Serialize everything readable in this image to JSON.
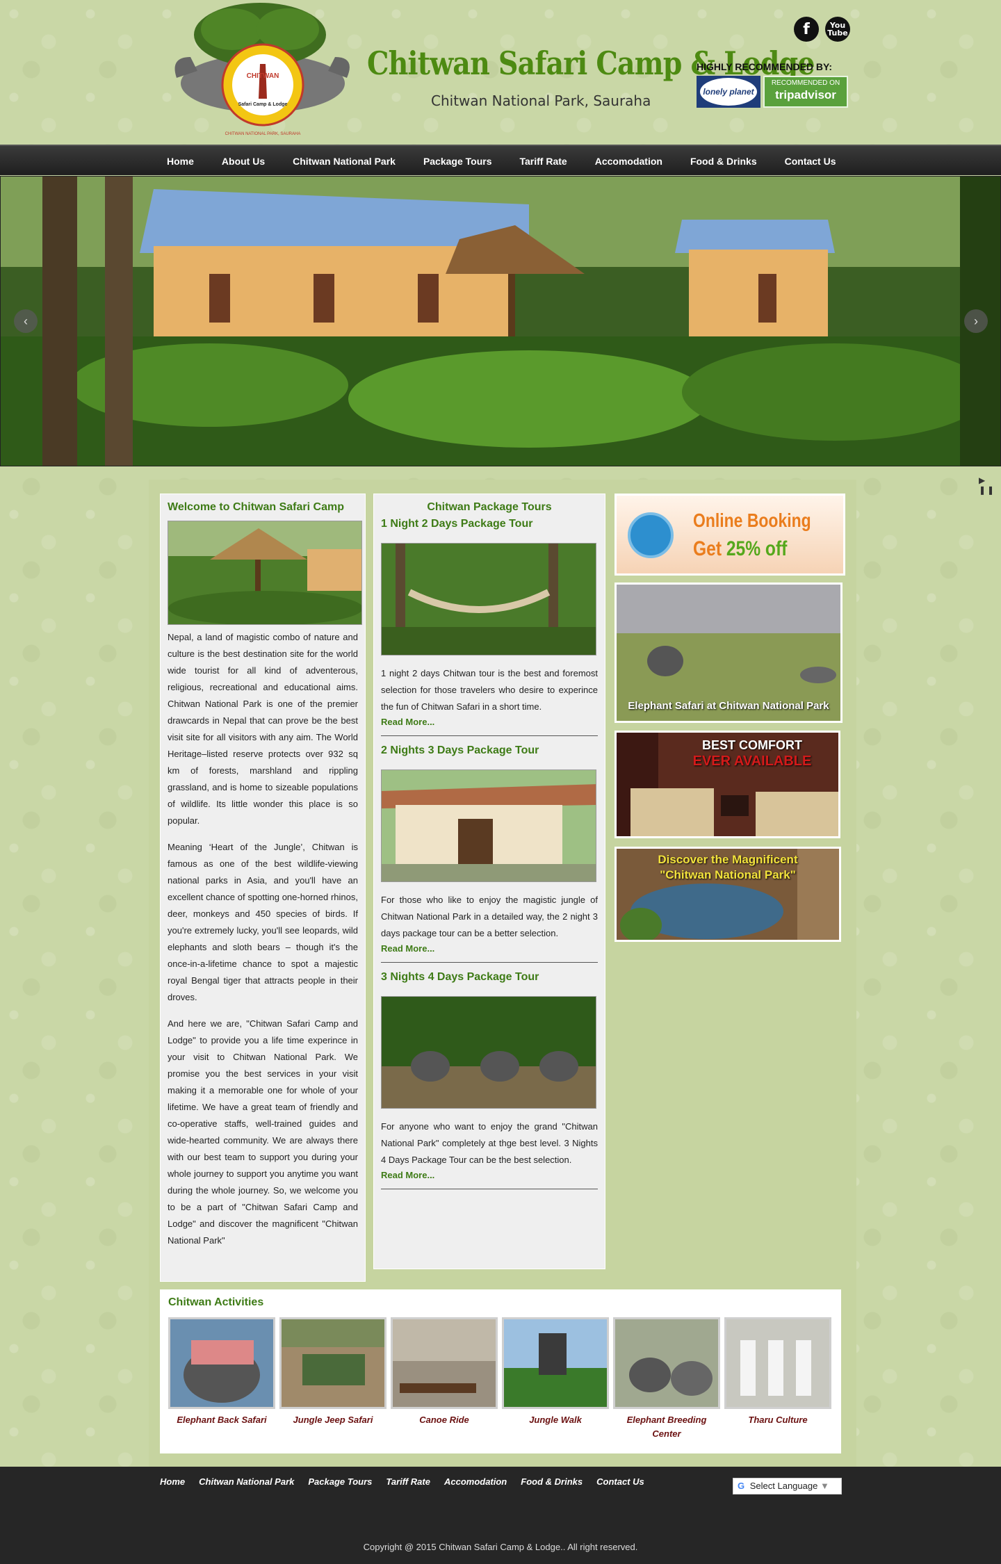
{
  "header": {
    "title": "Chitwan Safari Camp & Lodge",
    "subtitle": "Chitwan National Park, Sauraha",
    "recommended_label": "HIGHLY RECOMMENDED BY:",
    "logo_text_top": "CHITWAN",
    "logo_text_mid": "Safari Camp & Lodge",
    "logo_text_ring": "CHITWAN NATIONAL PARK, SAURAHA",
    "lonely_planet": "lonely planet",
    "tripadvisor_small": "RECOMMENDED ON",
    "tripadvisor_big": "tripadvisor",
    "social_facebook": "f",
    "social_youtube": "You Tube"
  },
  "nav": [
    "Home",
    "About Us",
    "Chitwan National Park",
    "Package Tours",
    "Tariff Rate",
    "Accomodation",
    "Food & Drinks",
    "Contact Us"
  ],
  "slider": {
    "prev": "‹",
    "next": "›",
    "controls": "▶ ❚❚"
  },
  "welcome": {
    "title": "Welcome to Chitwan Safari Camp",
    "paragraphs": [
      "Nepal, a land of magistic combo of nature and culture is the best destination site for the world wide tourist for all kind of adventerous, religious, recreational and educational aims. Chitwan National Park is one of the premier drawcards in Nepal that can prove be the best visit site for all visitors with any aim. The World Heritage–listed reserve protects over 932 sq km of forests, marshland and rippling grassland, and is home to sizeable populations of wildlife. Its little wonder this place is so popular.",
      "Meaning ‘Heart of the Jungle’, Chitwan is famous as one of the best wildlife-viewing national parks in Asia, and you'll have an excellent chance of spotting one-horned rhinos, deer, monkeys and 450 species of birds. If you're extremely lucky, you'll see leopards, wild elephants and sloth bears – though it's the once-in-a-lifetime chance to spot a majestic royal Bengal tiger that attracts people in their droves.",
      "And here we are, \"Chitwan Safari Camp and Lodge\" to provide you a life time experince in your visit to Chitwan National Park. We promise you the best services in your visit making it a memorable one for whole of your lifetime. We have a great team of friendly and co-operative staffs, well-trained guides and wide-hearted community. We are always there with our best team to support you during your whole journey to support you anytime you want during the whole journey. So, we welcome you to be a part of \"Chitwan Safari Camp and Lodge\" and discover the magnificent \"Chitwan National Park\""
    ]
  },
  "packages": {
    "title": "Chitwan Package Tours",
    "items": [
      {
        "title": "1 Night 2 Days Package Tour",
        "text": "1 night 2 days Chitwan tour is the best and foremost selection for those travelers who desire to experince the fun of Chitwan Safari in a short time.",
        "more": "Read More..."
      },
      {
        "title": "2 Nights 3 Days Package Tour",
        "text": "For those who like to enjoy the magistic jungle of Chitwan National Park in a detailed way, the 2 night 3 days package tour can be a better selection.",
        "more": "Read More..."
      },
      {
        "title": "3 Nights 4 Days Package Tour",
        "text": "For anyone who want to enjoy the grand \"Chitwan National Park\" completely at thge best level. 3 Nights 4 Days Package Tour can be the best selection.",
        "more": "Read More..."
      }
    ]
  },
  "banners": {
    "booking_line1": "Online Booking",
    "booking_line2a": "Get ",
    "booking_line2b": "25% off",
    "safari": "Elephant Safari at Chitwan National Park",
    "comfort1": "BEST COMFORT",
    "comfort2": "EVER AVAILABLE",
    "discover1": "Discover the Magnificent",
    "discover2": "\"Chitwan National Park\""
  },
  "activities": {
    "title": "Chitwan Activities",
    "items": [
      "Elephant Back Safari",
      "Jungle Jeep Safari",
      "Canoe Ride",
      "Jungle Walk",
      "Elephant Breeding Center",
      "Tharu Culture"
    ]
  },
  "footer": {
    "links": [
      "Home",
      "Chitwan National Park",
      "Package Tours",
      "Tariff Rate",
      "Accomodation",
      "Food & Drinks",
      "Contact Us"
    ],
    "language": "Select Language",
    "copyright": "Copyright @ 2015 Chitwan Safari Camp & Lodge.. All right reserved."
  },
  "colors": {
    "accent": "#3e7b16",
    "nav_bg": "#262626",
    "page_bg": "#c9d7a6"
  }
}
